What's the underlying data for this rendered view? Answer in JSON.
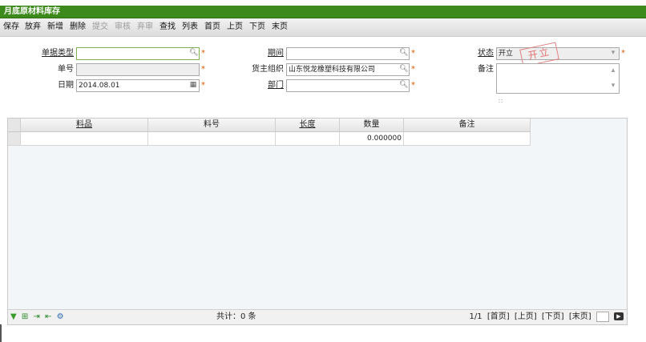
{
  "window": {
    "title": "月底原材料库存"
  },
  "toolbar": {
    "buttons": [
      {
        "label": "保存",
        "enabled": true
      },
      {
        "label": "放弃",
        "enabled": true
      },
      {
        "label": "新增",
        "enabled": true
      },
      {
        "label": "删除",
        "enabled": true
      },
      {
        "label": "提交",
        "enabled": false
      },
      {
        "label": "审核",
        "enabled": false
      },
      {
        "label": "弃审",
        "enabled": false
      },
      {
        "label": "查找",
        "enabled": true
      },
      {
        "label": "列表",
        "enabled": true
      },
      {
        "label": "首页",
        "enabled": true
      },
      {
        "label": "上页",
        "enabled": true
      },
      {
        "label": "下页",
        "enabled": true
      },
      {
        "label": "末页",
        "enabled": true
      }
    ]
  },
  "form": {
    "doc_type": {
      "label": "单据类型",
      "value": ""
    },
    "doc_no": {
      "label": "单号",
      "value": ""
    },
    "date": {
      "label": "日期",
      "value": "2014.08.01"
    },
    "period": {
      "label": "期间",
      "value": ""
    },
    "owner_org": {
      "label": "货主组织",
      "value": "山东悦龙橡塑科技有限公司"
    },
    "department": {
      "label": "部门",
      "value": ""
    },
    "status": {
      "label": "状态",
      "value": "开立",
      "stamp": "开立"
    },
    "remark": {
      "label": "备注",
      "value": ""
    },
    "required_mark": "*"
  },
  "grid": {
    "columns": [
      {
        "label": "料品",
        "underline": true
      },
      {
        "label": "料号",
        "underline": false
      },
      {
        "label": "长度",
        "underline": true
      },
      {
        "label": "数量",
        "underline": false
      },
      {
        "label": "备注",
        "underline": false
      }
    ],
    "rows": [
      {
        "item": "",
        "code": "",
        "length": "",
        "qty": "0.000000",
        "remark": ""
      }
    ],
    "footer": {
      "total": "共计：0 条",
      "page_info": "1/1",
      "first": "[首页]",
      "prev": "[上页]",
      "next": "[下页]",
      "last": "[末页]"
    }
  },
  "colors": {
    "title_bar": "#3d8a1c",
    "required": "#e05a00",
    "stamp": "#e57070"
  }
}
